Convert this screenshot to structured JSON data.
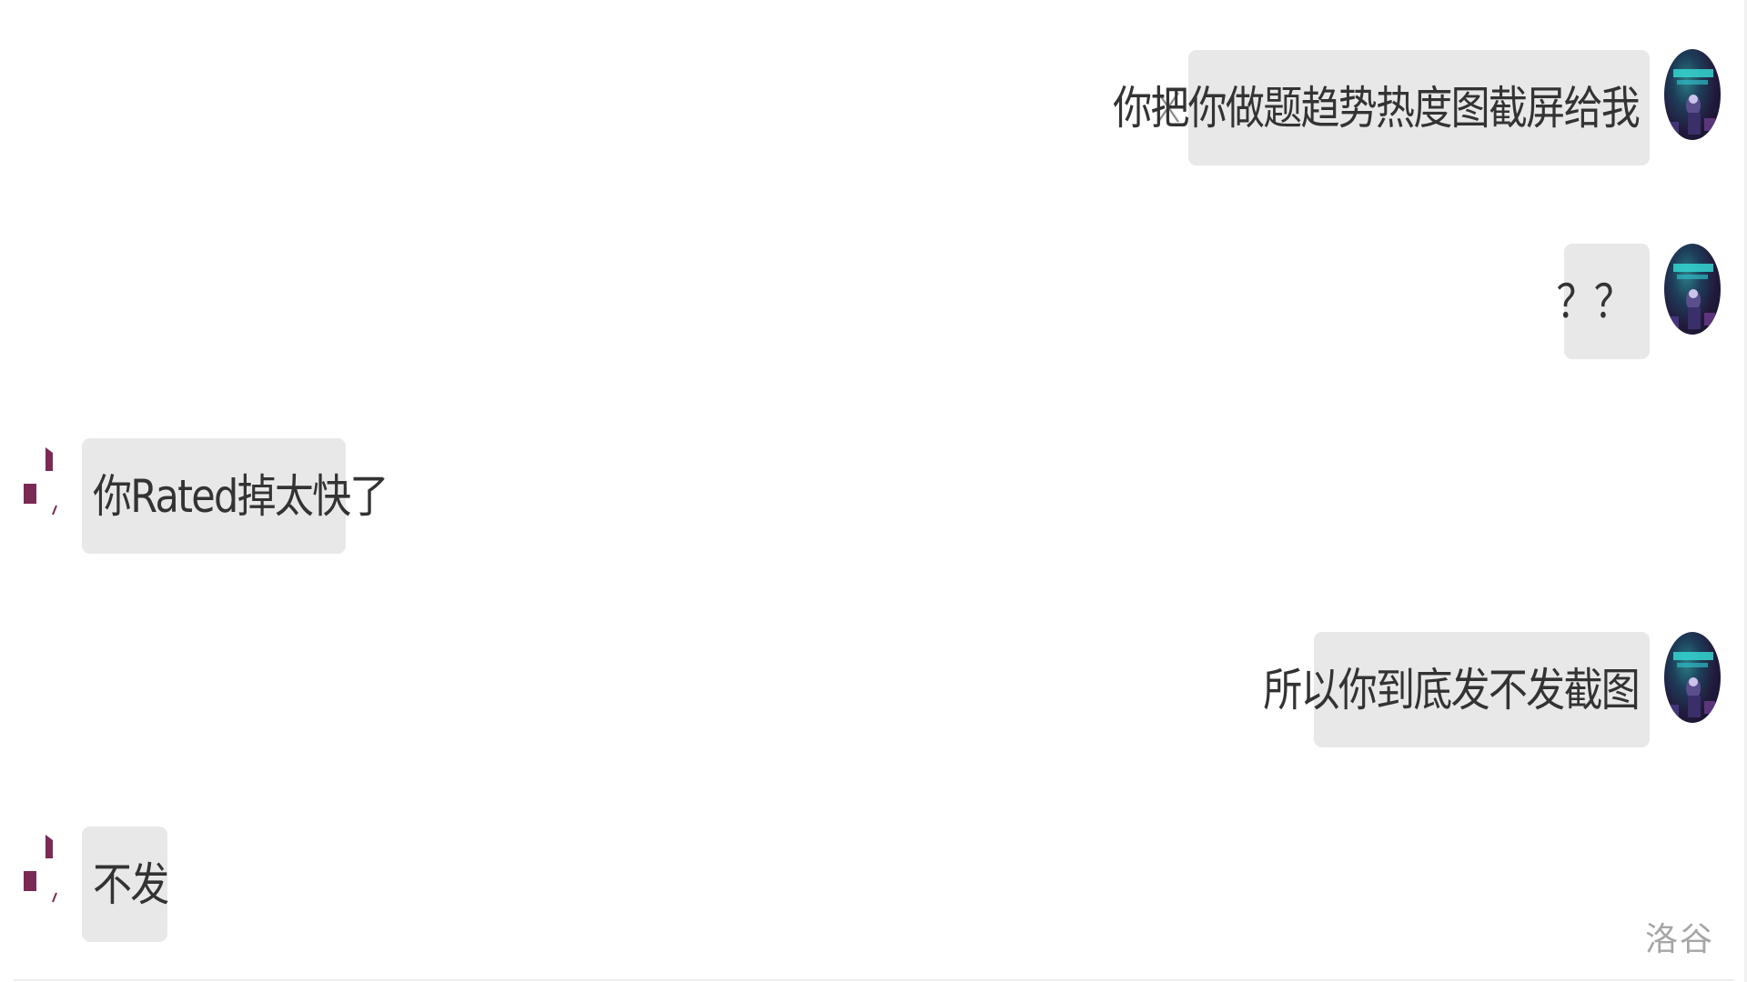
{
  "messages": [
    {
      "side": "right",
      "text": "你把你做题趋势热度图截屏给我"
    },
    {
      "side": "right",
      "text": "？？"
    },
    {
      "side": "left",
      "text": "你Rated掉太快了"
    },
    {
      "side": "right",
      "text": "所以你到底发不发截图"
    },
    {
      "side": "left",
      "text": "不发"
    }
  ],
  "watermark": "洛谷",
  "icons": {
    "close": "close-icon",
    "self_avatar": "avatar-self",
    "other_avatar": "avatar-other"
  },
  "colors": {
    "bubble": "#e8e8e8",
    "text": "#333333",
    "avatar_accent": "#7a2a55"
  }
}
